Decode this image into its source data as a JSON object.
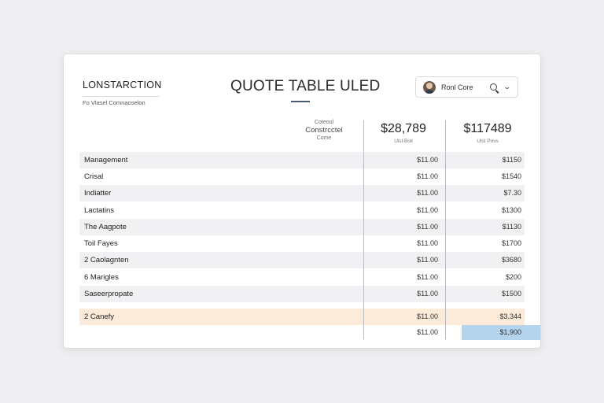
{
  "brand": {
    "name": "LONSTARCTION",
    "subtitle": "Fo Vlasel Comnaoselon"
  },
  "page_title": "QUOTE TABLE ULED",
  "user": {
    "name": "Ronl Core",
    "avatar_icon": "avatar",
    "search_icon": "search-icon",
    "dropdown_icon": "chevron-down-icon",
    "chevron_glyph": "⌄"
  },
  "columns": {
    "const": {
      "line1": "Coteoul",
      "line2": "Constrcctel",
      "line3": "Come"
    },
    "a": {
      "price": "$28,789",
      "sub": "Ulsl Boil"
    },
    "b": {
      "price": "$117489",
      "sub": "Ulst Povs"
    }
  },
  "rows": [
    {
      "label": "Management",
      "a": "$11.00",
      "b": "$1150"
    },
    {
      "label": "Crisal",
      "a": "$11.00",
      "b": "$1540"
    },
    {
      "label": "Indiatter",
      "a": "$11.00",
      "b": "$7.30"
    },
    {
      "label": "Lactatins",
      "a": "$11.00",
      "b": "$1300"
    },
    {
      "label": "The Aagpote",
      "a": "$11.00",
      "b": "$1130"
    },
    {
      "label": "Toil Fayes",
      "a": "$11.00",
      "b": "$1700"
    },
    {
      "label": "2 Caolagnten",
      "a": "$11.00",
      "b": "$3680"
    },
    {
      "label": "6 Marigles",
      "a": "$11.00",
      "b": "$200"
    },
    {
      "label": "Saseerpropate",
      "a": "$11.00",
      "b": "$1500"
    }
  ],
  "highlight_row": {
    "label": "2 Canefy",
    "a": "$11.00",
    "b": "$3.344"
  },
  "total_row": {
    "a": "$11.00",
    "b": "$1,900"
  },
  "colors": {
    "highlight": "#fcebd9",
    "total_cell": "#b4d4ee",
    "accent": "#4b5a73"
  }
}
